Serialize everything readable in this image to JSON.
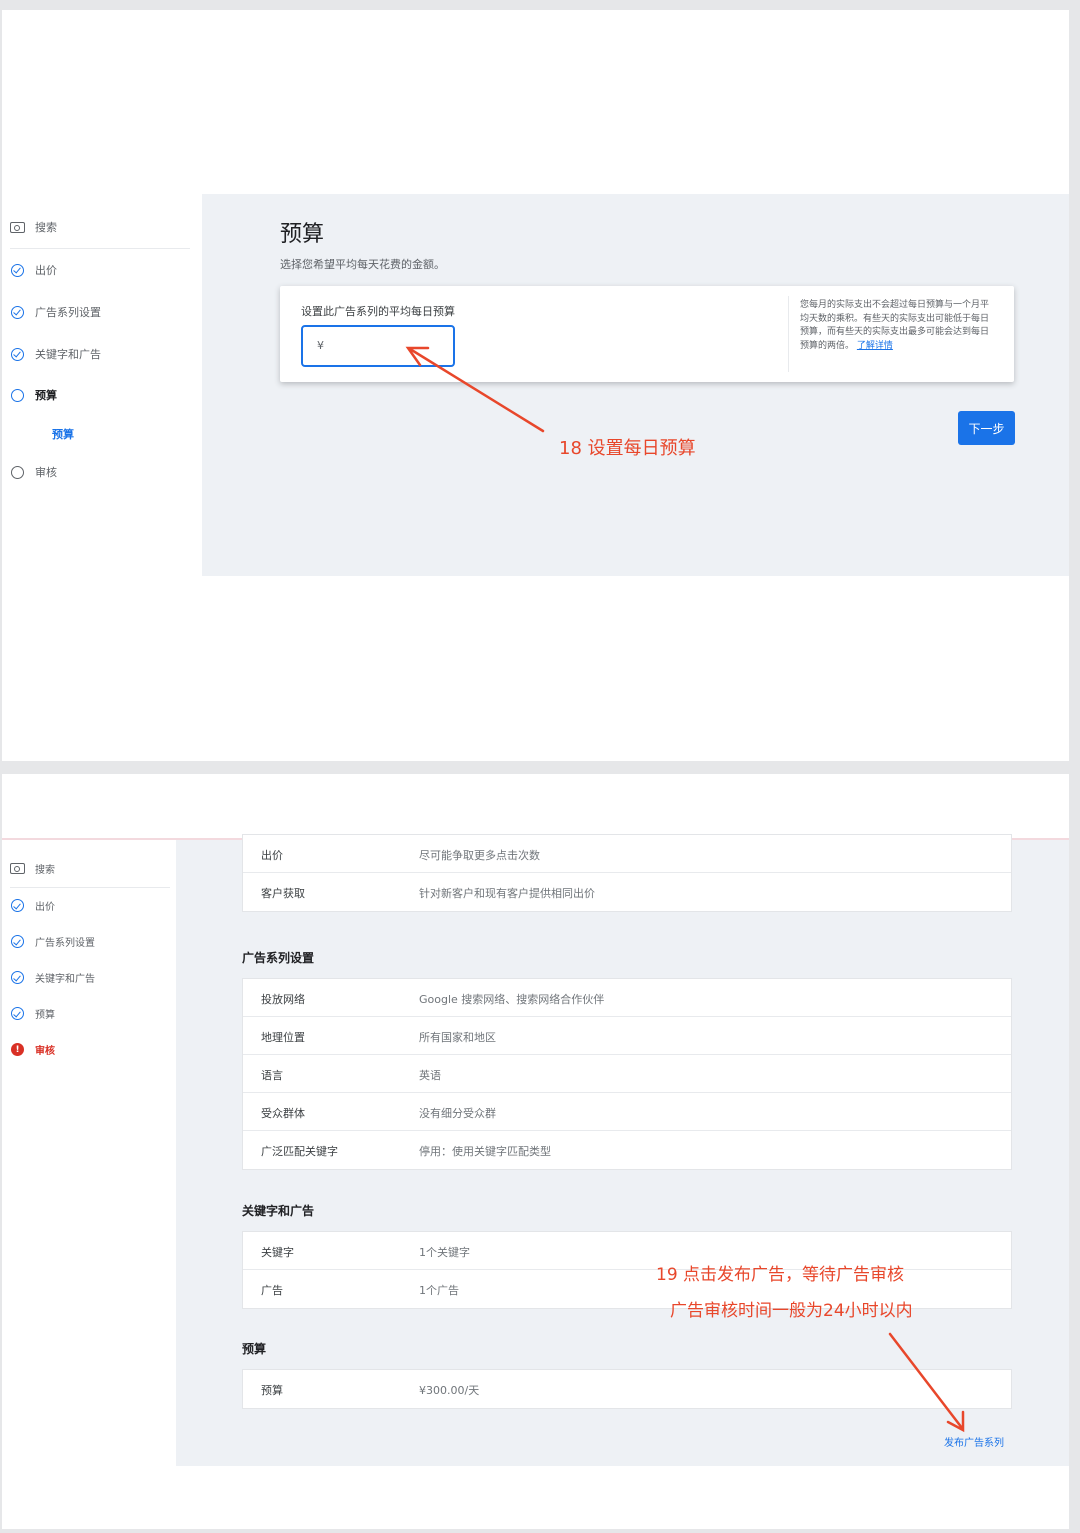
{
  "panel1": {
    "sidebar": [
      {
        "label": "搜索",
        "icon": "search-icon"
      },
      {
        "label": "出价",
        "icon": "check-circle-icon"
      },
      {
        "label": "广告系列设置",
        "icon": "check-circle-icon"
      },
      {
        "label": "关键字和广告",
        "icon": "check-circle-icon"
      },
      {
        "label": "预算",
        "icon": "current-step-circle-icon"
      },
      {
        "label": "预算",
        "icon": ""
      },
      {
        "label": "审核",
        "icon": "empty-circle-icon"
      }
    ],
    "title": "预算",
    "subtitle": "选择您希望平均每天花费的金额。",
    "card_label": "设置此广告系列的平均每日预算",
    "currency_value": "¥",
    "note": "您每月的实际支出不会超过每日预算与一个月平均天数的乘积。有些天的实际支出可能低于每日预算，而有些天的实际支出最多可能会达到每日预算的两倍。",
    "note_link": "了解详情",
    "next_button": "下一步",
    "annotation": "18 设置每日预算"
  },
  "panel2": {
    "sidebar": [
      {
        "label": "搜索",
        "icon": "search-icon"
      },
      {
        "label": "出价",
        "icon": "check-circle-icon"
      },
      {
        "label": "广告系列设置",
        "icon": "check-circle-icon"
      },
      {
        "label": "关键字和广告",
        "icon": "check-circle-icon"
      },
      {
        "label": "预算",
        "icon": "check-circle-icon"
      },
      {
        "label": "审核",
        "icon": "error-circle-icon"
      }
    ],
    "bidding_rows": [
      {
        "key": "出价",
        "value": "尽可能争取更多点击次数"
      },
      {
        "key": "客户获取",
        "value": "针对新客户和现有客户提供相同出价"
      }
    ],
    "campaign_settings_title": "广告系列设置",
    "campaign_rows": [
      {
        "key": "投放网络",
        "value": "Google 搜索网络、搜索网络合作伙伴"
      },
      {
        "key": "地理位置",
        "value": "所有国家和地区"
      },
      {
        "key": "语言",
        "value": "英语"
      },
      {
        "key": "受众群体",
        "value": "没有细分受众群"
      },
      {
        "key": "广泛匹配关键字",
        "value": "停用：使用关键字匹配类型"
      }
    ],
    "keywords_ads_title": "关键字和广告",
    "keywords_rows": [
      {
        "key": "关键字",
        "value": "1个关键字"
      },
      {
        "key": "广告",
        "value": "1个广告"
      }
    ],
    "budget_title": "预算",
    "budget_rows": [
      {
        "key": "预算",
        "value": "¥300.00/天"
      }
    ],
    "publish_link": "发布广告系列",
    "annotation_line1": "19 点击发布广告，等待广告审核",
    "annotation_line2": "广告审核时间一般为24小时以内"
  },
  "colors": {
    "accent": "#1a73e8",
    "annotation": "#e8472b",
    "error": "#d93025",
    "main_bg": "#eef1f5"
  }
}
